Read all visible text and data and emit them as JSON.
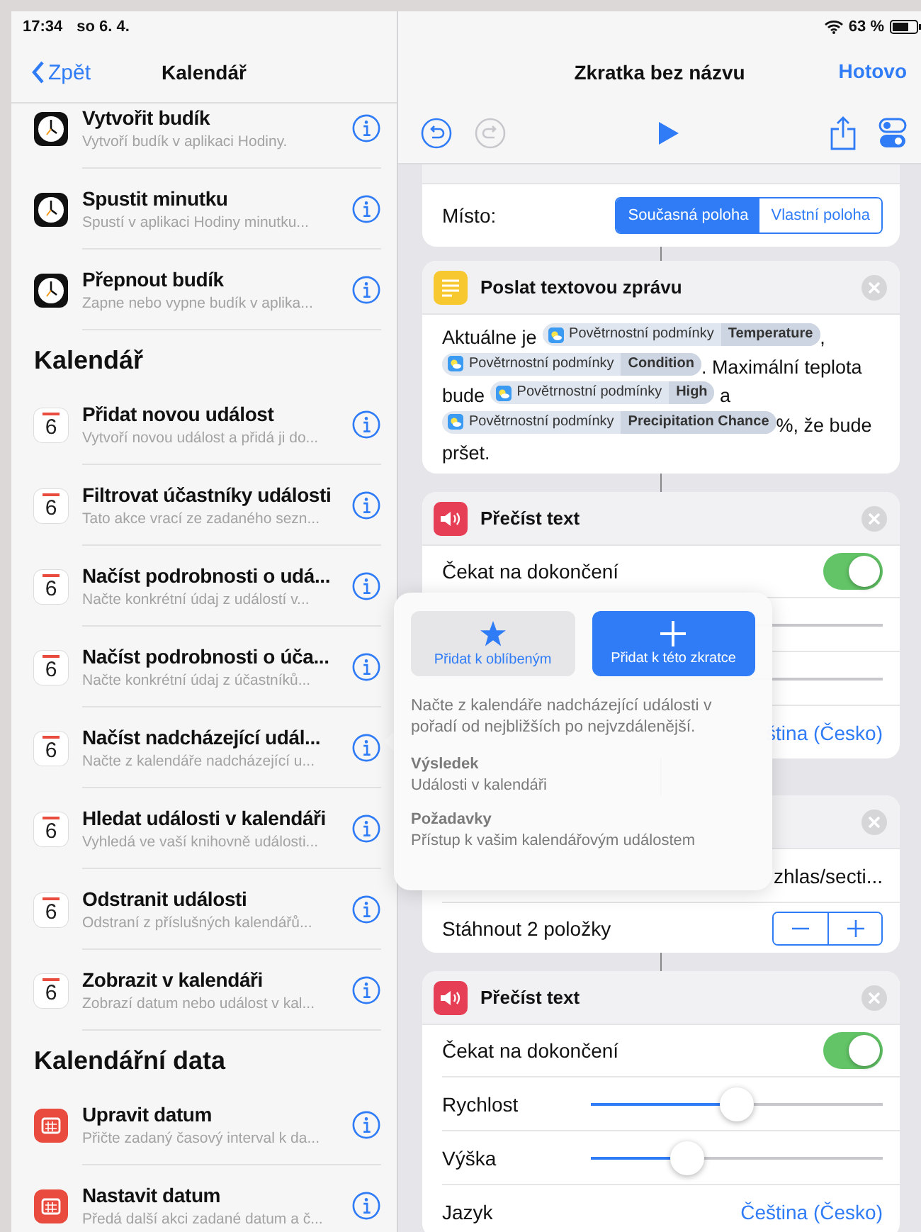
{
  "status_bar": {
    "time": "17:34",
    "date": "so 6. 4.",
    "battery": "63 %"
  },
  "sidebar": {
    "back": "Zpět",
    "title": "Kalendář",
    "sections": [
      {
        "items": [
          {
            "kind": "clock",
            "title": "Vytvořit budík",
            "subtitle": "Vytvoří budík v aplikaci Hodiny."
          },
          {
            "kind": "clock",
            "title": "Spustit minutku",
            "subtitle": "Spustí v aplikaci Hodiny minutku..."
          },
          {
            "kind": "clock",
            "title": "Přepnout budík",
            "subtitle": "Zapne nebo vypne budík v aplika..."
          }
        ]
      },
      {
        "title": "Kalendář",
        "items": [
          {
            "kind": "calendar",
            "day": "6",
            "title": "Přidat novou událost",
            "subtitle": "Vytvoří novou událost a přidá ji do..."
          },
          {
            "kind": "calendar",
            "day": "6",
            "title": "Filtrovat účastníky události",
            "subtitle": "Tato akce vrací ze zadaného sezn..."
          },
          {
            "kind": "calendar",
            "day": "6",
            "title": "Načíst podrobnosti o udá...",
            "subtitle": "Načte konkrétní údaj z událostí v..."
          },
          {
            "kind": "calendar",
            "day": "6",
            "title": "Načíst podrobnosti o úča...",
            "subtitle": "Načte konkrétní údaj z účastníků..."
          },
          {
            "kind": "calendar",
            "day": "6",
            "title": "Načíst nadcházející udál...",
            "subtitle": "Načte z kalendáře nadcházející u..."
          },
          {
            "kind": "calendar",
            "day": "6",
            "title": "Hledat události v kalendáři",
            "subtitle": "Vyhledá ve vaší knihovně události..."
          },
          {
            "kind": "calendar",
            "day": "6",
            "title": "Odstranit události",
            "subtitle": "Odstraní z příslušných kalendářů..."
          },
          {
            "kind": "calendar",
            "day": "6",
            "title": "Zobrazit v kalendáři",
            "subtitle": "Zobrazí datum nebo událost v kal..."
          }
        ]
      },
      {
        "title": "Kalendářní data",
        "items": [
          {
            "kind": "date",
            "title": "Upravit datum",
            "subtitle": "Přičte zadaný časový interval k da..."
          },
          {
            "kind": "date",
            "title": "Nastavit datum",
            "subtitle": "Předá další akci zadané datum a č..."
          }
        ]
      }
    ]
  },
  "editor": {
    "title": "Zkratka bez názvu",
    "done": "Hotovo",
    "cards": [
      {
        "rows": [
          {
            "kind": "segmented",
            "label": "Místo:",
            "options": [
              {
                "label": "Současná poloha",
                "selected": true
              },
              {
                "label": "Vlastní poloha",
                "selected": false
              }
            ]
          }
        ]
      },
      {
        "kind": "message",
        "title": "Poslat textovou zprávu",
        "body": [
          {
            "kind": "text",
            "text": "Aktuálne je "
          },
          {
            "kind": "token",
            "name": "Povětrnostní podmínky",
            "property": "Temperature"
          },
          {
            "kind": "text",
            "text": ", "
          },
          {
            "kind": "token",
            "name": "Povětrnostní podmínky",
            "property": "Condition"
          },
          {
            "kind": "text",
            "text": ". Maximální teplota bude "
          },
          {
            "kind": "token",
            "name": "Povětrnostní podmínky",
            "property": "High"
          },
          {
            "kind": "text",
            "text": " a "
          },
          {
            "kind": "token",
            "name": "Povětrnostní podmínky",
            "property": "Precipitation Chance"
          },
          {
            "kind": "text",
            "text": "%, že bude pršet."
          }
        ]
      },
      {
        "kind": "speech",
        "title": "Přečíst text",
        "rows": [
          {
            "kind": "toggle",
            "label": "Čekat na dokončení",
            "on": true
          },
          {
            "kind": "covered"
          },
          {
            "kind": "covered"
          },
          {
            "kind": "link",
            "value": "ština (Česko)"
          }
        ]
      },
      {
        "rows": [
          {
            "kind": "value",
            "value": "zhlas/secti..."
          },
          {
            "kind": "stepper",
            "label": "Stáhnout 2 položky"
          }
        ]
      },
      {
        "kind": "speech",
        "title": "Přečíst text",
        "rows": [
          {
            "kind": "toggle",
            "label": "Čekat na dokončení",
            "on": true
          },
          {
            "kind": "slider",
            "label": "Rychlost",
            "level": 0.5
          },
          {
            "kind": "slider",
            "label": "Výška",
            "level": 0.33
          },
          {
            "kind": "link",
            "label": "Jazyk",
            "value": "Čeština (Česko)"
          }
        ]
      }
    ]
  },
  "popover": {
    "favorite": "Přidat k oblíbeným",
    "add": "Přidat k této zkratce",
    "description": "Načte z kalendáře nadcházející události v pořadí od nejbližších po nejvzdálenější.",
    "sections": [
      {
        "heading": "Výsledek",
        "text": "Události v kalendáři"
      },
      {
        "heading": "Požadavky",
        "text": "Přístup k vašim kalendářovým událostem"
      }
    ]
  }
}
